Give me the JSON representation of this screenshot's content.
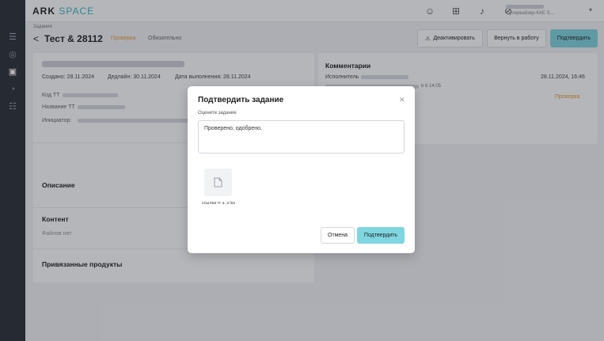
{
  "app": {
    "logo_main": "ARK",
    "logo_accent": "SPACE"
  },
  "header": {
    "user_role": "Супервайзер-КАЕ S..."
  },
  "page": {
    "breadcrumb": "Задания",
    "title": "Тест & 28112",
    "status": "Проверка",
    "type": "Обязательно",
    "actions": {
      "deactivate": "Деактивировать",
      "return": "Вернуть в работу",
      "confirm": "Подтвердить"
    }
  },
  "task": {
    "created": "Создано: 28.11.2024",
    "deadline": "Дедлайн: 30.11.2024",
    "completed": "Дата выполнения: 28.11.2024",
    "fields": {
      "code": "Код ТТ",
      "name": "Название ТТ",
      "initiator": "Инициатор:"
    },
    "sections": {
      "description": "Описание",
      "content": "Контент",
      "no_files": "Файлов нет",
      "products": "Привязанные продукты"
    }
  },
  "comments": {
    "title": "Комментарии",
    "author_label": "Исполнитель",
    "date": "28.11.2024, 16:46",
    "text_tail": "b 6 14:05",
    "status": "Проверка"
  },
  "modal": {
    "title": "Подтвердить задание",
    "label": "Оцените задание",
    "comment_value": "Проверено, одобрено.",
    "file_name": "ссылка тг з..з lsx",
    "cancel": "Отмена",
    "confirm": "Подтвердить"
  }
}
